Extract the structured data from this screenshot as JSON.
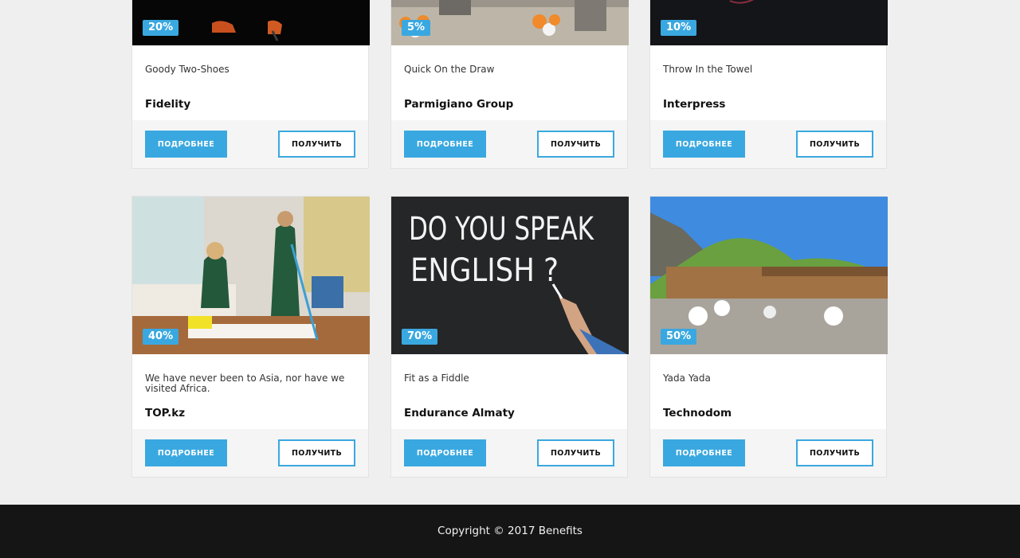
{
  "cards": [
    {
      "discount": "20%",
      "desc": "Goody Two-Shoes",
      "name": "Fidelity",
      "more_label": "ПОДРОБНЕЕ",
      "get_label": "ПОЛУЧИТЬ",
      "image": "dark-photo-sneakers"
    },
    {
      "discount": "5%",
      "desc": "Quick On the Draw",
      "name": "Parmigiano Group",
      "more_label": "ПОДРОБНЕЕ",
      "get_label": "ПОЛУЧИТЬ",
      "image": "mall-balloons-photo"
    },
    {
      "discount": "10%",
      "desc": "Throw In the Towel",
      "name": "Interpress",
      "more_label": "ПОДРОБНЕЕ",
      "get_label": "ПОЛУЧИТЬ",
      "image": "dark-photo"
    },
    {
      "discount": "40%",
      "desc": "We have never been to Asia, nor have we visited Africa.",
      "name": "TOP.kz",
      "more_label": "ПОДРОБНЕЕ",
      "get_label": "ПОЛУЧИТЬ",
      "image": "cleaning-service-photo"
    },
    {
      "discount": "70%",
      "desc": "Fit as a Fiddle",
      "name": "Endurance Almaty",
      "more_label": "ПОДРОБНЕЕ",
      "get_label": "ПОЛУЧИТЬ",
      "image": "chalkboard-photo",
      "image_text_1": "DO YOU SPEAK",
      "image_text_2": "ENGLISH ?"
    },
    {
      "discount": "50%",
      "desc": "Yada Yada",
      "name": "Technodom",
      "more_label": "ПОДРОБНЕЕ",
      "get_label": "ПОЛУЧИТЬ",
      "image": "mountain-terrace-photo"
    }
  ],
  "footer": {
    "copyright": "Copyright © 2017 Benefits"
  },
  "colors": {
    "accent": "#3aa8e0",
    "footer_bg": "#151515",
    "page_bg": "#efefef"
  }
}
